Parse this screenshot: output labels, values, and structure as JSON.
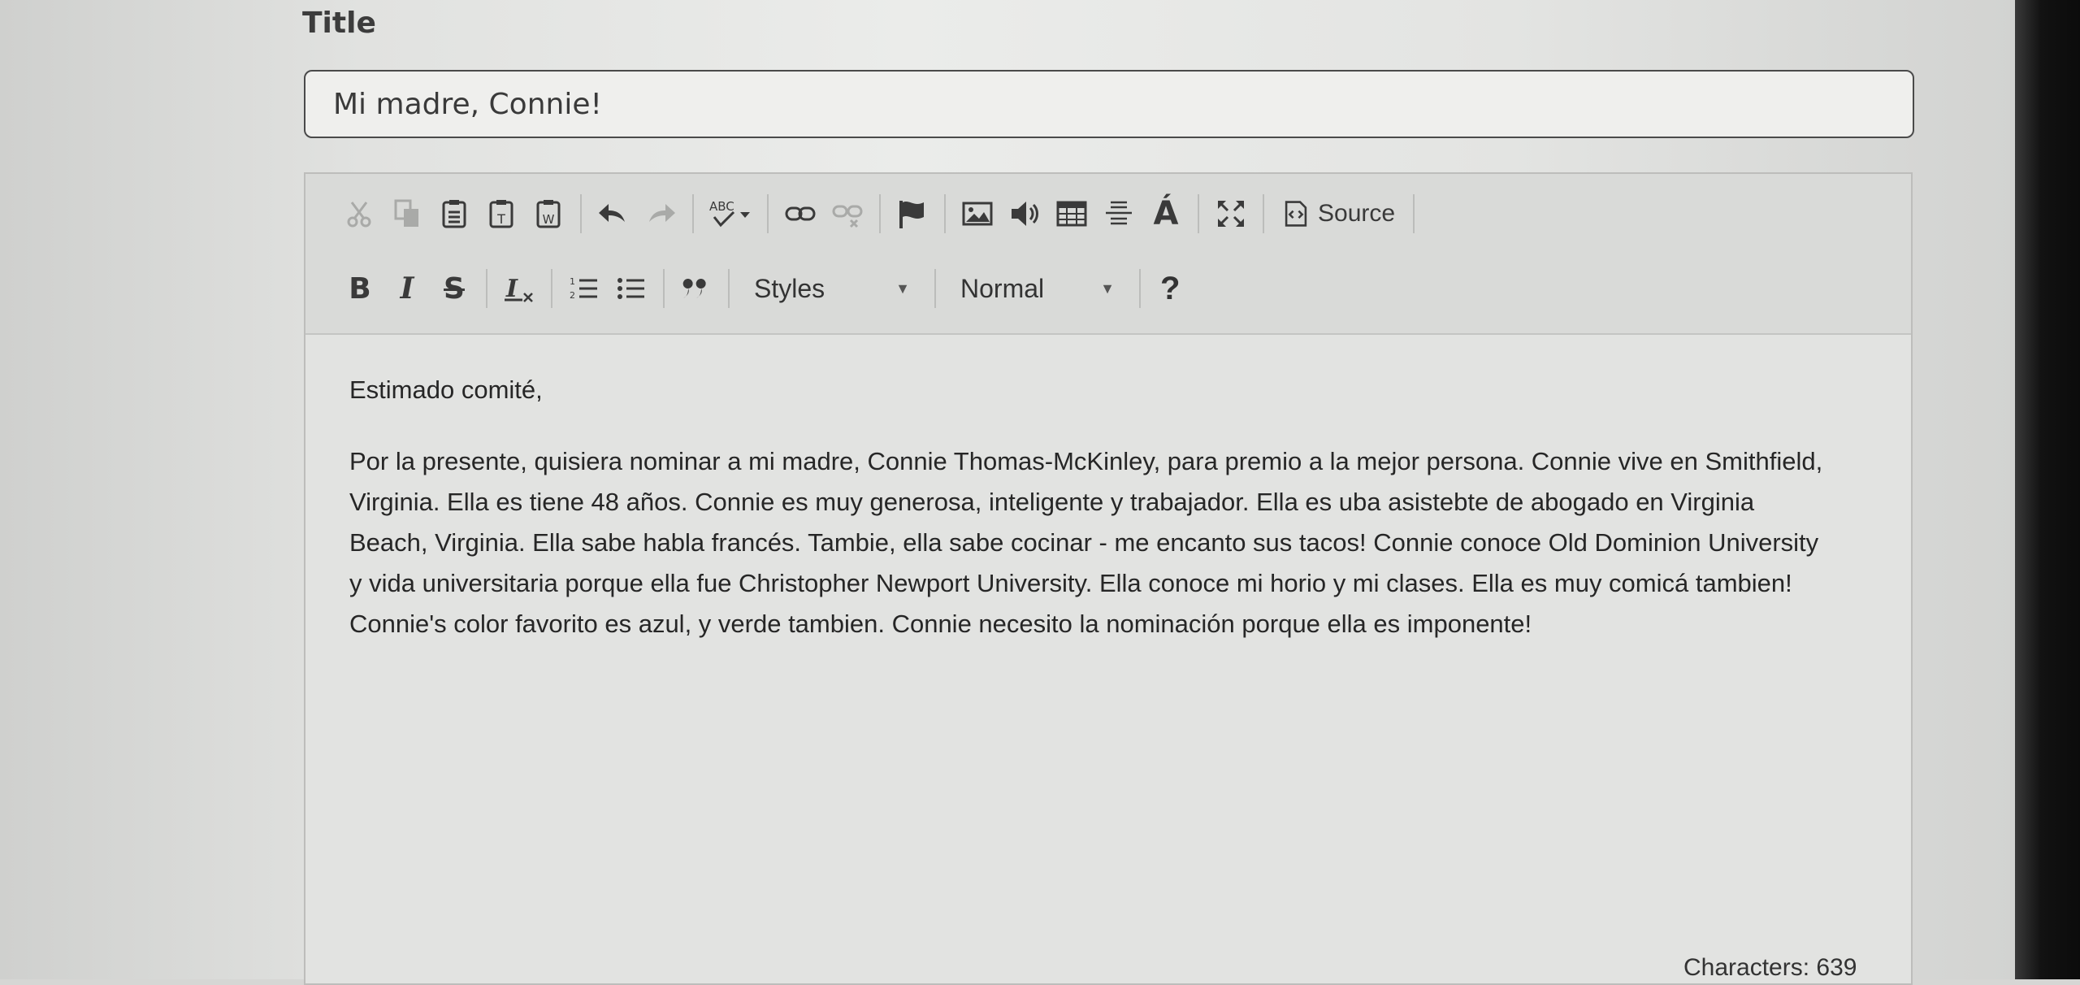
{
  "form": {
    "title_label": "Title",
    "title_value": "Mi madre, Connie!"
  },
  "toolbar": {
    "row1": [
      {
        "name": "cut-icon",
        "state": "disabled"
      },
      {
        "name": "copy-icon",
        "state": "disabled"
      },
      {
        "name": "paste-icon"
      },
      {
        "name": "paste-text-icon"
      },
      {
        "name": "paste-from-word-icon"
      },
      {
        "name": "undo-icon"
      },
      {
        "name": "redo-icon",
        "state": "disabled"
      },
      {
        "name": "spellcheck-icon",
        "label": "ABC"
      },
      {
        "name": "link-icon"
      },
      {
        "name": "unlink-icon",
        "state": "disabled"
      },
      {
        "name": "anchor-flag-icon"
      },
      {
        "name": "image-icon"
      },
      {
        "name": "audio-icon"
      },
      {
        "name": "table-icon"
      },
      {
        "name": "horizontal-line-icon"
      },
      {
        "name": "special-character-icon",
        "label": "Á"
      },
      {
        "name": "maximize-icon"
      }
    ],
    "source_label": "Source",
    "row2": {
      "bold_label": "B",
      "italic_label": "I",
      "strike_label": "S",
      "styles_label": "Styles",
      "format_label": "Normal",
      "help_label": "?"
    }
  },
  "content": {
    "salutation": "Estimado comité,",
    "body": "Por la presente, quisiera nominar a mi madre, Connie Thomas-McKinley, para premio a la mejor persona. Connie vive en Smithfield, Virginia. Ella es tiene 48 años. Connie es muy generosa, inteligente y trabajador. Ella es uba asistebte de abogado en Virginia Beach, Virginia. Ella sabe habla francés. Tambie, ella sabe cocinar - me encanto sus tacos! Connie conoce Old Dominion University y vida universitaria porque ella fue Christopher Newport University. Ella conoce mi horio y mi clases. Ella es muy comicá tambien! Connie's color favorito es azul, y verde tambien. Connie necesito la nominación porque ella es imponente!"
  },
  "status": {
    "characters": "Characters: 639"
  },
  "colors": {
    "text": "#262626",
    "toolbar_bg": "#d9dad8",
    "editor_bg": "#e2e3e1",
    "disabled_icon": "#a9aaa8"
  }
}
